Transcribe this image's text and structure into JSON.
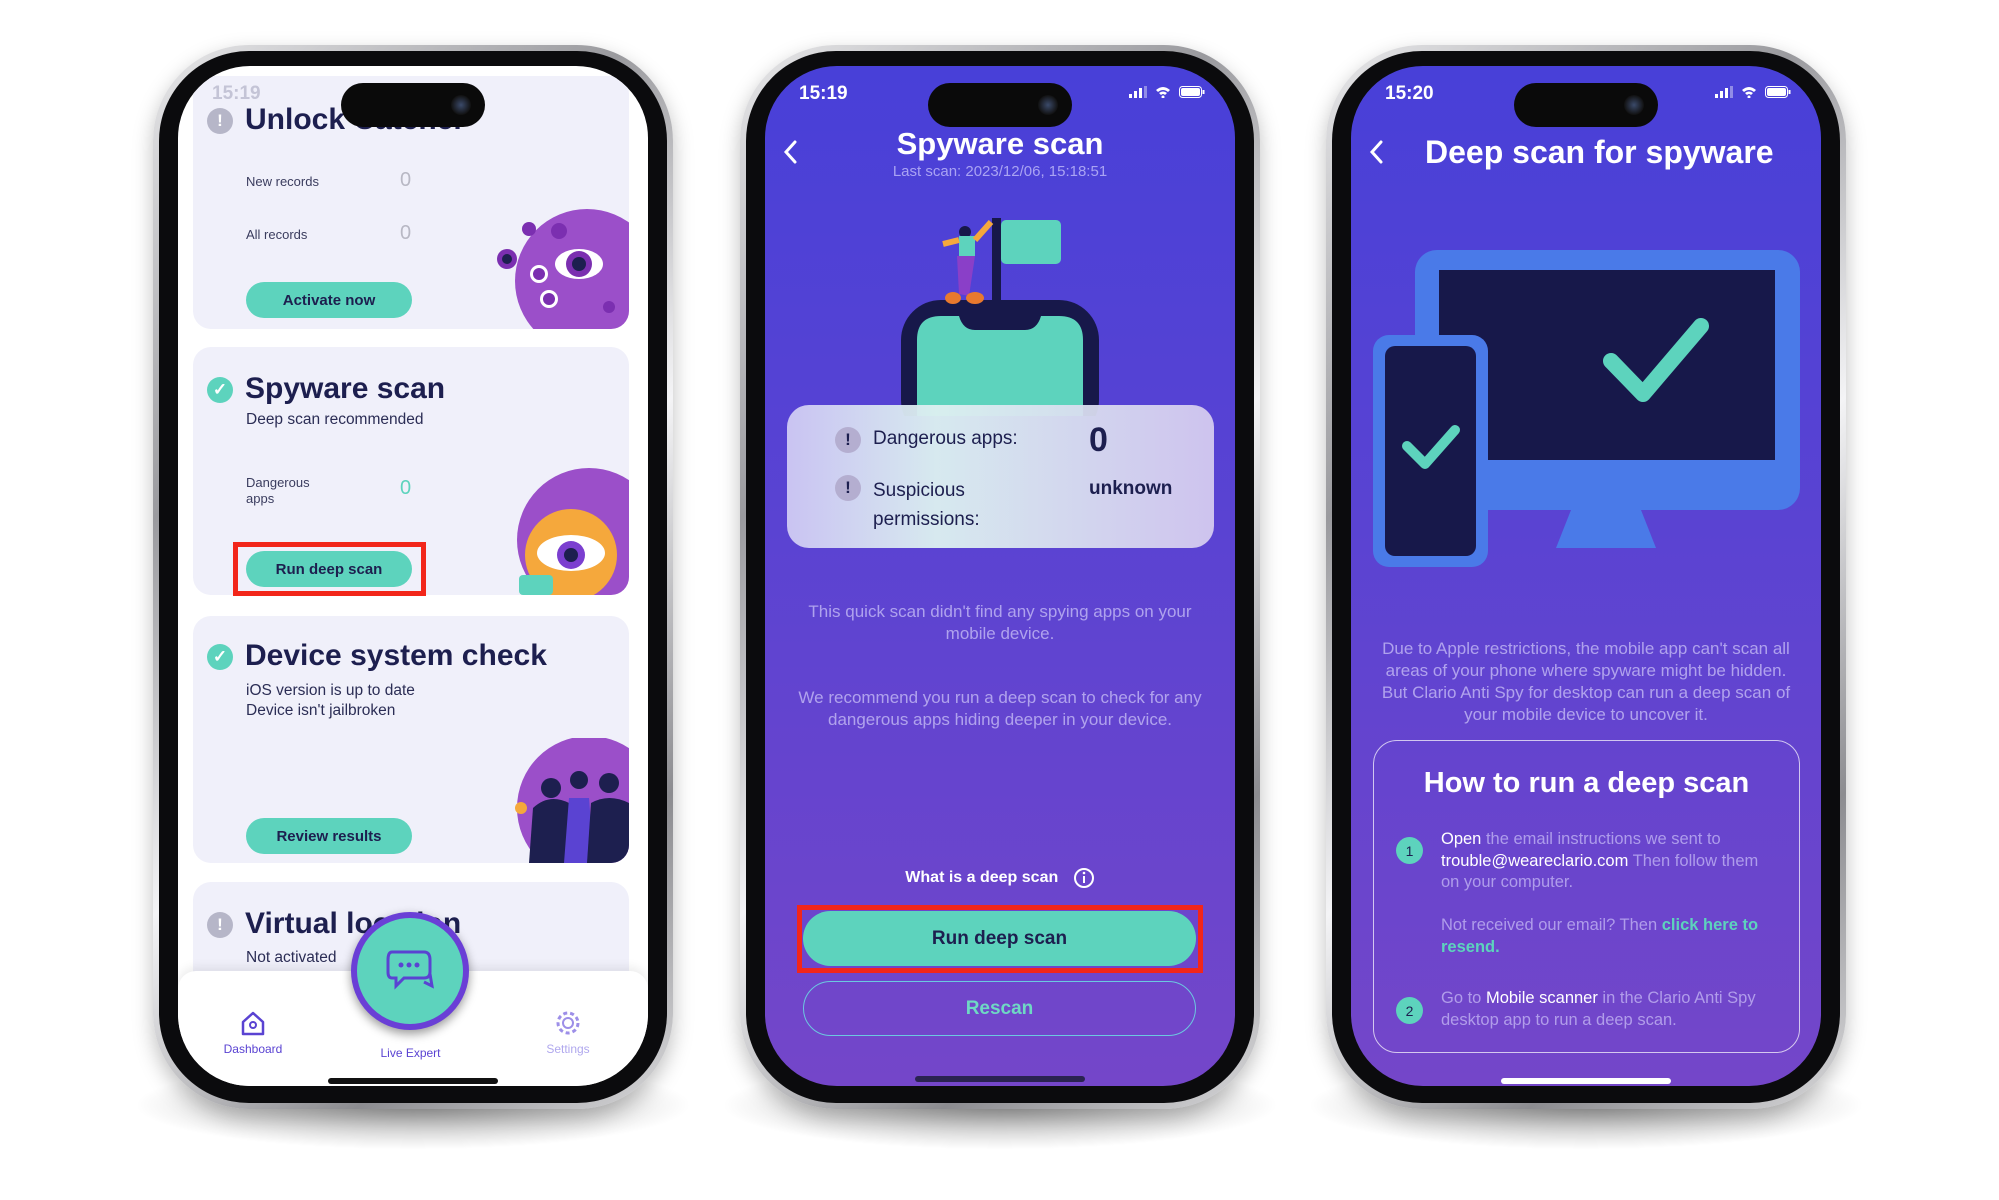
{
  "colors": {
    "teal": "#5dd3bd",
    "navy": "#1d1f4f",
    "purple_top": "#4840d8",
    "purple_bottom": "#7446c9",
    "highlight": "#f2261a"
  },
  "dashboard": {
    "status_time": "15:19",
    "cards": [
      {
        "title": "Unlock Catcher",
        "status_icon": "exclamation-icon",
        "rows": [
          {
            "label": "New records",
            "value": "0"
          },
          {
            "label": "All records",
            "value": "0"
          }
        ],
        "button": "Activate now"
      },
      {
        "title": "Spyware scan",
        "status_icon": "check-icon",
        "subtitle": "Deep scan recommended",
        "rows": [
          {
            "label": "Dangerous apps",
            "value": "0"
          }
        ],
        "button": "Run deep scan"
      },
      {
        "title": "Device system check",
        "status_icon": "check-icon",
        "lines": [
          "iOS version is up to date",
          "Device isn't jailbroken"
        ],
        "button": "Review results"
      },
      {
        "title": "Virtual location",
        "status_icon": "exclamation-icon",
        "subtitle": "Not activated"
      }
    ],
    "nav": [
      {
        "label": "Dashboard",
        "icon": "home-icon"
      },
      {
        "label": "Live Expert",
        "icon": "chat-bubbles-icon"
      },
      {
        "label": "Settings",
        "icon": "gear-icon"
      }
    ]
  },
  "spyware_scan": {
    "status_time": "15:19",
    "title": "Spyware scan",
    "last_scan": "Last scan: 2023/12/06, 15:18:51",
    "results": [
      {
        "label": "Dangerous apps:",
        "value": "0"
      },
      {
        "label": "Suspicious permissions:",
        "value": "unknown"
      }
    ],
    "message1": "This quick scan didn't find any spying apps on your mobile device.",
    "message2": "We recommend you run a deep scan to check for any dangerous apps hiding deeper in your device.",
    "info_link": "What is a deep scan",
    "primary_button": "Run deep scan",
    "secondary_button": "Rescan"
  },
  "deep_scan": {
    "status_time": "15:20",
    "title": "Deep scan for spyware",
    "description": "Due to Apple restrictions, the mobile app can't scan all areas of your phone where spyware might be hidden. But Clario Anti Spy for desktop can run a deep scan of your mobile device to uncover it.",
    "howto_title": "How to run a deep scan",
    "step1": {
      "number": "1",
      "bold": "Open",
      "text1": " the email instructions we sent to ",
      "email": "trouble@weareclario.com",
      "text2": " Then follow them on your computer."
    },
    "resend": {
      "text": "Not received our email? Then ",
      "link": "click here to resend."
    },
    "step2": {
      "number": "2",
      "text1": "Go to ",
      "bold": "Mobile scanner",
      "text2": " in the Clario Anti Spy desktop app to run a deep scan."
    }
  }
}
